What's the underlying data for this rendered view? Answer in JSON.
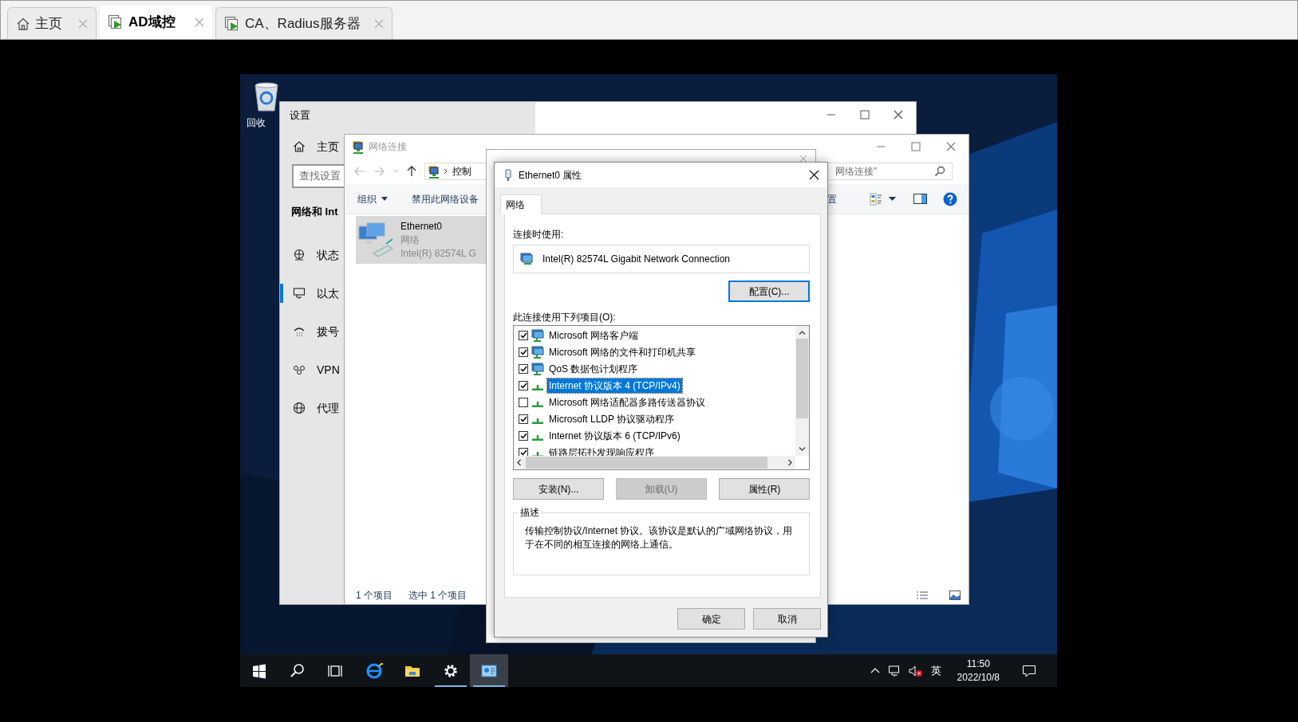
{
  "app_tabs": [
    {
      "label": "主页",
      "kind": "home",
      "selected": false
    },
    {
      "label": "AD域控",
      "kind": "vm",
      "selected": true
    },
    {
      "label": "CA、Radius服务器",
      "kind": "vm",
      "selected": false
    }
  ],
  "desktop": {
    "recycle_bin_label": "回收"
  },
  "settings_window": {
    "title": "设置",
    "home_label": "主页",
    "search_placeholder": "查找设置",
    "section_title": "网络和 Int",
    "nav": [
      {
        "label": "状态",
        "kind": "status",
        "selected": false
      },
      {
        "label": "以太",
        "kind": "ethernet",
        "selected": true
      },
      {
        "label": "拨号",
        "kind": "dialup",
        "selected": false
      },
      {
        "label": "VPN",
        "kind": "vpn",
        "selected": false
      },
      {
        "label": "代理",
        "kind": "proxy",
        "selected": false
      }
    ]
  },
  "network_window": {
    "title": "网络连接",
    "address": "控制",
    "search_value": "网络连接\"",
    "toolbar": [
      "组织",
      "禁用此网络设备",
      "置"
    ],
    "adapter": {
      "name": "Ethernet0",
      "status": "网络",
      "device": "Intel(R) 82574L G",
      "selected": true
    },
    "status_bar": [
      "1 个项目",
      "选中 1 个项目"
    ]
  },
  "properties_dialog": {
    "title": "Ethernet0 属性",
    "tabs": [
      {
        "label": "网络",
        "selected": true
      }
    ],
    "connect_using_label": "连接时使用:",
    "adapter": "Intel(R) 82574L Gigabit Network Connection",
    "configure_button": "配置(C)...",
    "items_label": "此连接使用下列项目(O):",
    "items": [
      {
        "label": "Microsoft 网络客户端",
        "kind": "client",
        "checked": true,
        "selected": false
      },
      {
        "label": "Microsoft 网络的文件和打印机共享",
        "kind": "client",
        "checked": true,
        "selected": false
      },
      {
        "label": "QoS 数据包计划程序",
        "kind": "client",
        "checked": true,
        "selected": false
      },
      {
        "label": "Internet 协议版本 4 (TCP/IPv4)",
        "kind": "protocol",
        "checked": true,
        "selected": true
      },
      {
        "label": "Microsoft 网络适配器多路传送器协议",
        "kind": "protocol",
        "checked": false,
        "selected": false
      },
      {
        "label": "Microsoft LLDP 协议驱动程序",
        "kind": "protocol",
        "checked": true,
        "selected": false
      },
      {
        "label": "Internet 协议版本 6 (TCP/IPv6)",
        "kind": "protocol",
        "checked": true,
        "selected": false
      },
      {
        "label": "链路层拓扑发现响应程序",
        "kind": "protocol",
        "checked": true,
        "selected": false
      }
    ],
    "buttons": [
      {
        "label": "安装(N)...",
        "disabled": false
      },
      {
        "label": "卸载(U)",
        "disabled": true
      },
      {
        "label": "属性(R)",
        "disabled": false
      }
    ],
    "description_title": "描述",
    "description": "传输控制协议/Internet 协议。该协议是默认的广域网络协议，用于在不同的相互连接的网络上通信。",
    "dialog_buttons": [
      "确定",
      "取消"
    ]
  },
  "taskbar": {
    "apps": [
      {
        "kind": "start",
        "running": false,
        "selected": false
      },
      {
        "kind": "search",
        "running": false,
        "selected": false
      },
      {
        "kind": "taskview",
        "running": false,
        "selected": false
      },
      {
        "kind": "browser",
        "running": false,
        "selected": false
      },
      {
        "kind": "explorer",
        "running": false,
        "selected": false
      },
      {
        "kind": "settings",
        "running": true,
        "selected": false
      },
      {
        "kind": "network",
        "running": true,
        "selected": true
      }
    ],
    "ime": "英",
    "time": "11:50",
    "date": "2022/10/8"
  }
}
